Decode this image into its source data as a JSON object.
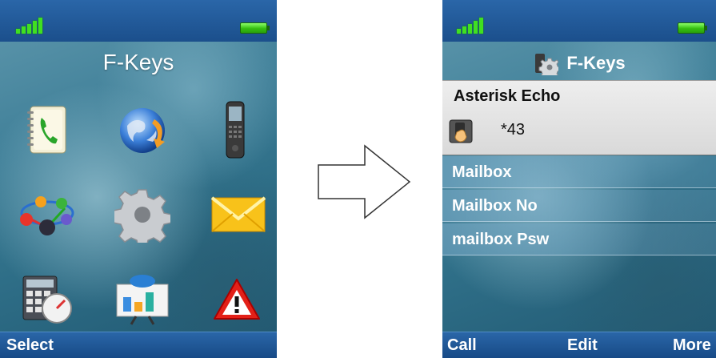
{
  "left_screen": {
    "title": "F-Keys",
    "icons": [
      "phonebook-icon",
      "globe-icon",
      "handset-icon",
      "network-icon",
      "settings-gear-icon",
      "messages-envelope-icon",
      "calculator-icon",
      "presentation-icon",
      "warning-icon"
    ],
    "softkeys": {
      "left": "Select"
    }
  },
  "right_screen": {
    "title": "F-Keys",
    "selected_item": {
      "name": "Asterisk Echo",
      "number": "*43"
    },
    "items": [
      "Mailbox",
      "Mailbox No",
      "mailbox Psw"
    ],
    "softkeys": {
      "left": "Call",
      "center": "Edit",
      "right": "More"
    }
  },
  "colors": {
    "status_bar": "#1b4f8c",
    "signal": "#40e020",
    "battery": "#35c010",
    "selection_bg": "#e0e0e0"
  }
}
